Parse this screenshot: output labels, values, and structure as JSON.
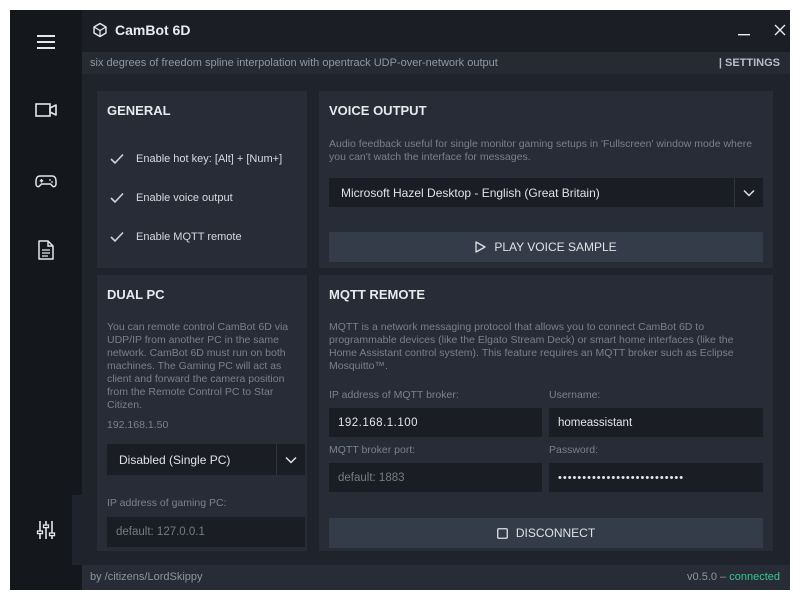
{
  "app": {
    "title": "CamBot 6D",
    "subtitle": "six degrees of freedom spline interpolation with opentrack UDP-over-network output",
    "settings_label": "| SETTINGS"
  },
  "sidebar": {
    "items": [
      {
        "icon": "menu-icon"
      },
      {
        "icon": "camera-icon"
      },
      {
        "icon": "gamepad-icon"
      },
      {
        "icon": "document-icon"
      },
      {
        "icon": "sliders-icon",
        "active": true
      }
    ]
  },
  "general": {
    "title": "GENERAL",
    "options": [
      {
        "label": "Enable hot key: [Alt] + [Num+]",
        "checked": true
      },
      {
        "label": "Enable voice output",
        "checked": true
      },
      {
        "label": "Enable MQTT remote",
        "checked": true
      }
    ]
  },
  "voice": {
    "title": "VOICE OUTPUT",
    "description": "Audio feedback useful for single monitor gaming setups in 'Fullscreen' window mode where you can't watch the interface for messages.",
    "selected_voice": "Microsoft Hazel Desktop - English (Great Britain)",
    "play_label": "PLAY VOICE SAMPLE"
  },
  "dual_pc": {
    "title": "DUAL PC",
    "description": "You can remote control CamBot 6D via UDP/IP from another PC in the same network. CamBot 6D must run on both machines. The Gaming PC will act as client and forward the camera position from the Remote Control PC to Star Citizen.",
    "local_ip": "192.168.1.50",
    "mode": "Disabled (Single PC)",
    "gaming_ip_label": "IP address of gaming PC:",
    "gaming_ip_placeholder": "default: 127.0.0.1"
  },
  "mqtt": {
    "title": "MQTT REMOTE",
    "description": "MQTT is a network messaging protocol that allows you to connect CamBot 6D to programmable devices (like the Elgato Stream Deck) or smart home interfaces (like the Home Assistant control system). This feature requires an MQTT broker such as Eclipse Mosquitto™.",
    "broker_ip_label": "IP address of MQTT broker:",
    "broker_ip": "192.168.1.100",
    "username_label": "Username:",
    "username": "homeassistant",
    "port_label": "MQTT broker port:",
    "port_placeholder": "default: 1883",
    "password_label": "Password:",
    "password": "••••••••••••••••••••••••••",
    "disconnect_label": "DISCONNECT"
  },
  "footer": {
    "credit": "by /citizens/LordSkippy",
    "version": "v0.5.0 –",
    "status": "connected"
  },
  "colors": {
    "accent_green": "#35c98f",
    "panel": "#272c36",
    "background": "#1f232b",
    "sidebar": "#14171c"
  }
}
